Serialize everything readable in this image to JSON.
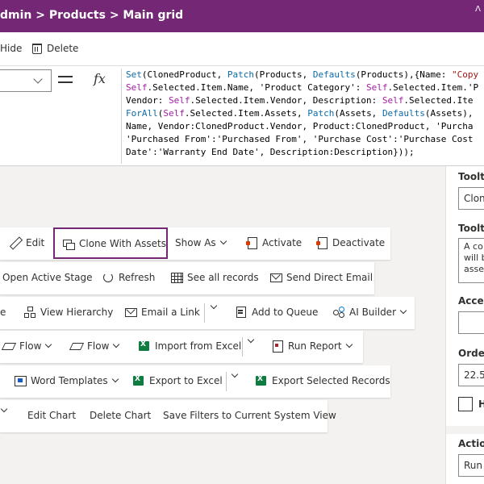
{
  "header": {
    "breadcrumb": "dmin > Products > Main grid",
    "corner_glyph": "Λ"
  },
  "toolbar": {
    "hide_label": "Hide",
    "delete_label": "Delete"
  },
  "formula_bar": {
    "equals_icon": "equals-icon",
    "fx_label": "fx",
    "lines": [
      "Set(ClonedProduct, Patch(Products, Defaults(Products),{Name: \"Cop",
      "Self.Selected.Item.Name, 'Product Category': Self.Selected.Item.'P",
      "Vendor: Self.Selected.Item.Vendor, Description: Self.Selected.Ite",
      "ForAll(Self.Selected.Item.Assets, Patch(Assets, Defaults(Assets),",
      "Name, Vendor:ClonedProduct.Vendor, Product:ClonedProduct, 'Purcha",
      "'Purchased From':'Purchased From', 'Purchase Cost':'Purchase Cost",
      "Date':'Warranty End Date', Description:Description}));"
    ]
  },
  "commands": {
    "row1": {
      "edit": "Edit",
      "clone_with_assets": "Clone With Assets",
      "show_as": "Show As",
      "activate": "Activate",
      "deactivate": "Deactivate"
    },
    "row2": {
      "open_active_stage": "Open Active Stage",
      "refresh": "Refresh",
      "see_all_records": "See all records",
      "send_direct_email": "Send Direct Email"
    },
    "row3": {
      "partial": "e",
      "view_hierarchy": "View Hierarchy",
      "email_a_link": "Email a Link",
      "add_to_queue": "Add to Queue",
      "ai_builder": "AI Builder"
    },
    "row4": {
      "flow_1": "Flow",
      "flow_2": "Flow",
      "import_from_excel": "Import from Excel",
      "run_report": "Run Report"
    },
    "row5": {
      "word_templates": "Word Templates",
      "export_to_excel": "Export to Excel",
      "export_selected_records": "Export Selected Records"
    },
    "row6": {
      "edit_chart": "Edit Chart",
      "delete_chart": "Delete Chart",
      "save_filters": "Save Filters to Current System View"
    }
  },
  "properties": {
    "tooltip_label_1": "Tooltip",
    "tooltip_value_1": "Clon",
    "tooltip_label_2": "Tooltip",
    "tooltip_text_lines": [
      "A co",
      "will b",
      "asse"
    ],
    "access_label": "Acces",
    "access_value": "",
    "order_label": "Order",
    "order_value": "22.5",
    "hidden_label": "H",
    "action_label": "Action",
    "action_value": "Run"
  },
  "colors": {
    "brand": "#742774",
    "formula_function": "#0c6ba9",
    "formula_self": "#a31fa3",
    "formula_string": "#a31515",
    "excel_green": "#107c41"
  }
}
